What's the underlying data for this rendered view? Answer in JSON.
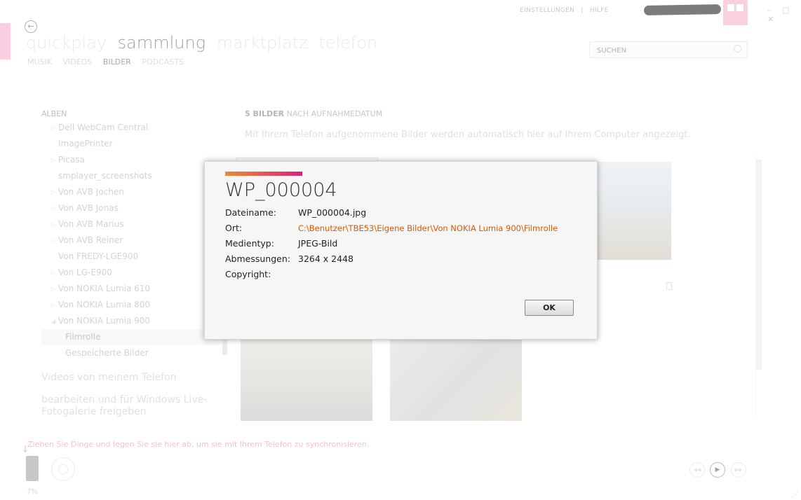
{
  "top_links": {
    "settings": "EINSTELLUNGEN",
    "separator": "|",
    "help": "HILFE"
  },
  "window_buttons": "– □ ✕",
  "pivot": {
    "items": [
      "quickplay",
      "sammlung",
      "marktplatz",
      "telefon"
    ],
    "active": "sammlung"
  },
  "subnav": {
    "items": [
      "MUSIK",
      "VIDEOS",
      "BILDER",
      "PODCASTS"
    ],
    "active": "BILDER"
  },
  "search": {
    "placeholder": "SUCHEN"
  },
  "albums": {
    "header": "ALBEN",
    "items": [
      {
        "label": "Dell WebCam Central",
        "expandable": true
      },
      {
        "label": "ImagePrinter",
        "expandable": false
      },
      {
        "label": "Picasa",
        "expandable": true
      },
      {
        "label": "smplayer_screenshots",
        "expandable": false
      },
      {
        "label": "Von AVB Jochen",
        "expandable": true
      },
      {
        "label": "Von AVB Jonas",
        "expandable": true
      },
      {
        "label": "Von AVB Marius",
        "expandable": true
      },
      {
        "label": "Von AVB Reiner",
        "expandable": true
      },
      {
        "label": "Von FREDY-LGE900",
        "expandable": false
      },
      {
        "label": "Von LG-E900",
        "expandable": true
      },
      {
        "label": "Von NOKIA Lumia 610",
        "expandable": true
      },
      {
        "label": "Von NOKIA Lumia 800",
        "expandable": true
      },
      {
        "label": "Von NOKIA Lumia 900",
        "expanded": true
      },
      {
        "label": "Filmrolle",
        "sub": true,
        "selected": true
      },
      {
        "label": "Gespeicherte Bilder",
        "sub": true
      }
    ],
    "link_videos": "Videos von meinem Telefon",
    "link_edit": "bearbeiten und für Windows Live-Fotogalerie freigeben"
  },
  "main": {
    "count": "5 BILDER",
    "sort": "NACH AUFNAHMEDATUM",
    "info": "Mit Ihrem Telefon aufgenommene Bilder werden automatisch hier auf Ihrem Computer angezeigt."
  },
  "bottom": {
    "sync_text": "Ziehen Sie Dinge und legen Sie sie hier ab, um sie mit Ihrem Telefon zu synchronisieren.",
    "percent": "7%"
  },
  "dialog": {
    "title": "WP_000004",
    "rows": [
      {
        "key": "Dateiname:",
        "value": "WP_000004.jpg"
      },
      {
        "key": "Ort:",
        "value": "C:\\Benutzer\\TBE53\\Eigene Bilder\\Von NOKIA Lumia 900\\Filmrolle"
      },
      {
        "key": "Medientyp:",
        "value": "JPEG-Bild"
      },
      {
        "key": "Abmessungen:",
        "value": "3264 x 2448"
      },
      {
        "key": "Copyright:",
        "value": ""
      }
    ],
    "ok_label": "OK"
  },
  "colors": {
    "accent_pink": "#e78cbd",
    "path_orange": "#d65a00",
    "accent_gradient": [
      "#f08a30",
      "#e0207a"
    ]
  }
}
